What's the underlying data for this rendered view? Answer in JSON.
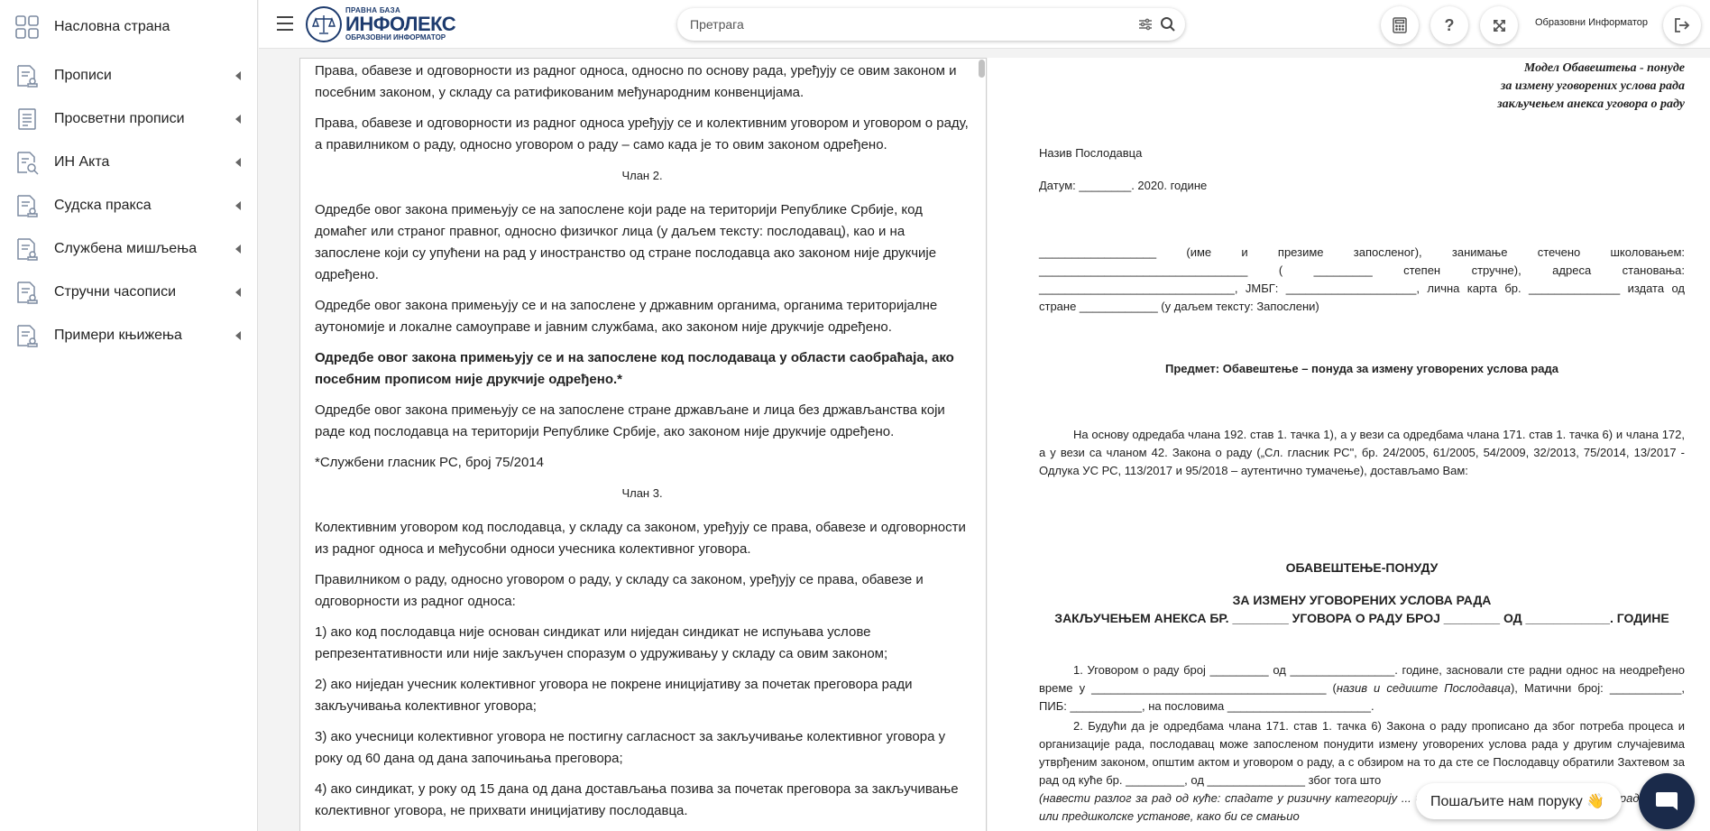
{
  "sidebar": {
    "items": [
      {
        "label": "Насловна страна",
        "icon": "dashboard-grid-icon",
        "has_children": false
      },
      {
        "label": "Прописи",
        "icon": "document-stamp-icon",
        "has_children": true
      },
      {
        "label": "Просветни прописи",
        "icon": "document-list-icon",
        "has_children": true
      },
      {
        "label": "ИН Акта",
        "icon": "document-search-icon",
        "has_children": true
      },
      {
        "label": "Судска пракса",
        "icon": "document-stamp-icon",
        "has_children": true
      },
      {
        "label": "Службена мишљења",
        "icon": "document-stamp-icon",
        "has_children": true
      },
      {
        "label": "Стручни часописи",
        "icon": "document-stamp-icon",
        "has_children": true
      },
      {
        "label": "Примери књижења",
        "icon": "document-stamp-icon",
        "has_children": true
      }
    ]
  },
  "header": {
    "logo_small": "ПРАВНА БАЗА",
    "logo_big": "ИНФОЛЕКС",
    "logo_sub": "ОБРАЗОВНИ ИНФОРМАТОР",
    "search_placeholder": "Претрага",
    "user_label": "Образовни Информатор",
    "help_label": "?"
  },
  "left_document": {
    "blocks": [
      {
        "type": "p",
        "text": "Права, обавезе и одговорности из радног односа, односно по основу рада, уређују се овим законом и посебним законом, у складу са ратификованим међународним конвенцијама."
      },
      {
        "type": "p",
        "text": "Права, обавезе и одговорности из радног односа уређују се и колективним уговором и уговором о раду, а правилником о раду, односно уговором о раду – само када је то овим законом одређено."
      },
      {
        "type": "clan",
        "text": "Члан 2."
      },
      {
        "type": "p",
        "text": "Одредбе овог закона примењују се на запослене који раде на територији Републике Србије, код домаћег или страног правног, односно физичког лица (у даљем тексту: послодавац), као и на запослене који су упућени на рад у иностранство од стране послодавца ако законом није друкчије одређено."
      },
      {
        "type": "p",
        "text": "Одредбе овог закона примењују се и на запослене у државним органима, органима територијалне аутономије и локалне самоуправе и јавним службама, ако законом није друкчије одређено."
      },
      {
        "type": "bold",
        "text": "Одредбе овог закона примењују се и на запослене код послодаваца у области саобраћаја, ако посебним прописом није друкчије одређено.*"
      },
      {
        "type": "p",
        "text": "Одредбе овог закона примењују се на запослене стране држављане и лица без држављанства који раде код послодавца на територији Републике Србије, ако законом није друкчије одређено."
      },
      {
        "type": "p",
        "text": "*Службени гласник РС, број 75/2014"
      },
      {
        "type": "clan",
        "text": "Члан 3."
      },
      {
        "type": "p",
        "text": "Колективним уговором код послодавца, у складу са законом, уређују се права, обавезе и одговорности из радног односа и међусобни односи учесника колективног уговора."
      },
      {
        "type": "p",
        "text": "Правилником о раду, односно уговором о раду, у складу са законом, уређују се права, обавезе и одговорности из радног односа:"
      },
      {
        "type": "p",
        "text": "1) ако код послодавца није основан синдикат или ниједан синдикат не испуњава услове репрезентативности или није закључен споразум о удруживању у складу са овим законом;"
      },
      {
        "type": "p",
        "text": "2) ако ниједан учесник колективног уговора не покрене иницијативу за почетак преговора ради закључивања колективног уговора;"
      },
      {
        "type": "p",
        "text": "3) ако учесници колективног уговора не постигну сагласност за закључивање колективног уговора у року од 60 дана од дана започињања преговора;"
      },
      {
        "type": "p",
        "text": "4) ако синдикат, у року од 15 дана од дана достављања позива за почетак преговора за закључивање колективног уговора, не прихвати иницијативу послодавца."
      }
    ]
  },
  "right_document": {
    "model_line1": "Модел Обавештења - понуде",
    "model_line2": "за измену уговорених услова рада",
    "model_line3": "закључењем анекса уговора о раду",
    "employer_name": "Назив Послодавца",
    "date_line": "Датум: ________. 2020.  године",
    "employee_para": "__________________    (име и презиме запосленог), занимање стечено школовањем: ________________________________ ( _________ степен стручне), адреса становања: ______________________________, ЈМБГ: ____________________, лична карта бр. ______________ издата од стране ____________ (у даљем тексту: Запослени)",
    "subject": "Предмет: Обавештење – понуда за измену уговорених услова рада",
    "intro_para": "На основу одредаба члана 192. став 1. тачка 1), а у вези са одредбама члана 171. став 1. тачка 6) и члана 172, а у вези са чланом 42. Закона о раду („Сл. гласник РС\", бр. 24/2005, 61/2005, 54/2009, 32/2013, 75/2014, 13/2017 - Одлука УС РС, 113/2017 и 95/2018 – аутентично тумачење), достављамо Вам:",
    "heading1": "ОБАВЕШТЕЊЕ-ПОНУДУ",
    "heading2": "ЗА ИЗМЕНУ УГОВОРЕНИХ УСЛОВА РАДА",
    "heading3": "ЗАКЉУЧЕЊЕМ АНЕКСА БР. ________ УГОВОРА О РАДУ БРОЈ ________ ОД ____________. ГОДИНЕ",
    "item1_a": "1. Уговором о раду број _________ од ________________. године,  засновали сте радни однос на неодређено време у ____________________________________ (",
    "item1_italic": "назив и седиште Послодавца",
    "item1_b": "), Матични број: ___________, ПИБ: ___________, на пословима ______________________.",
    "item2": "2. Будући да је одредбама члана 171. став 1. тачка 6) Закона о раду прописано да због потреба процеса и организације рада, послодавац може запосленом понудити измену уговорених услова рада у другим случајевима утврђеним законом, општим актом и уговором о раду, а с обзиром на то да сте се Послодавцу обратили Захтевом за рад од куће бр. _________, од _______________ због тога што",
    "item2_italic": "(навести разлог за рад од куће: спадате у ризичну категорију ... или бринете о деци због обуставе рада школе или предшколске установе, како би се смањио"
  },
  "chat": {
    "prompt": "Пошаљите нам поруку 👋"
  }
}
